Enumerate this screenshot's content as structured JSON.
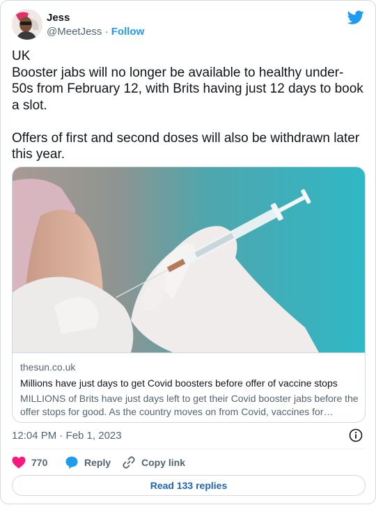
{
  "author": {
    "name": "Jess",
    "handle": "@MeetJess",
    "separator": "·",
    "follow_label": "Follow"
  },
  "tweet": {
    "text": "UK\nBooster jabs will no longer be available to healthy under-50s from February 12, with Brits having just 12 days to book a slot.\n\nOffers of first and second doses will also be withdrawn later this year."
  },
  "link_card": {
    "domain": "thesun.co.uk",
    "title": "Millions have just days to get Covid boosters before offer of vaccine stops",
    "description": "MILLIONS of Brits have just days left to get their Covid booster jabs before the offer stops for good. As the country moves on from Covid, vaccines for health…"
  },
  "meta": {
    "timestamp": "12:04 PM · Feb 1, 2023"
  },
  "actions": {
    "like_count": "770",
    "reply_label": "Reply",
    "copy_label": "Copy link"
  },
  "footer": {
    "read_replies_label": "Read 133 replies"
  },
  "colors": {
    "brand": "#1d9bf0",
    "heart": "#f91880",
    "muted": "#536471",
    "border": "#cfd9de"
  },
  "icons": [
    "twitter-bird-icon",
    "heart-icon",
    "reply-bubble-icon",
    "link-icon",
    "info-icon"
  ]
}
